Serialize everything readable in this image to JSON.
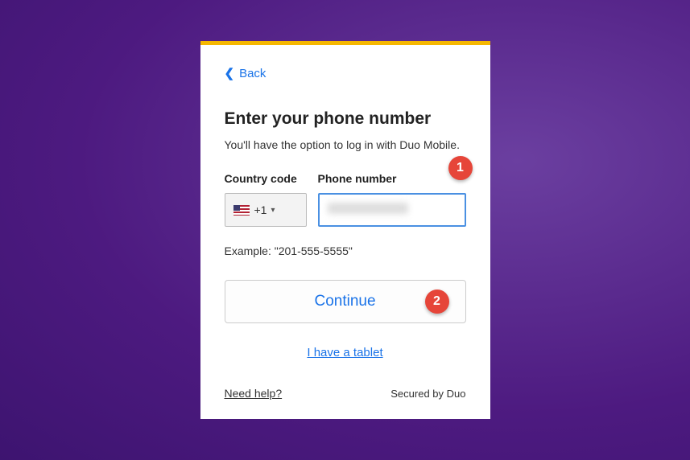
{
  "back_label": "Back",
  "title": "Enter your phone number",
  "subtitle": "You'll have the option to log in with Duo Mobile.",
  "fields": {
    "country_label": "Country code",
    "country_code": "+1",
    "phone_label": "Phone number"
  },
  "example_text": "Example: \"201-555-5555\"",
  "continue_label": "Continue",
  "tablet_link": "I have a tablet",
  "help_link": "Need help?",
  "secured_by": "Secured by Duo",
  "badges": {
    "one": "1",
    "two": "2"
  }
}
